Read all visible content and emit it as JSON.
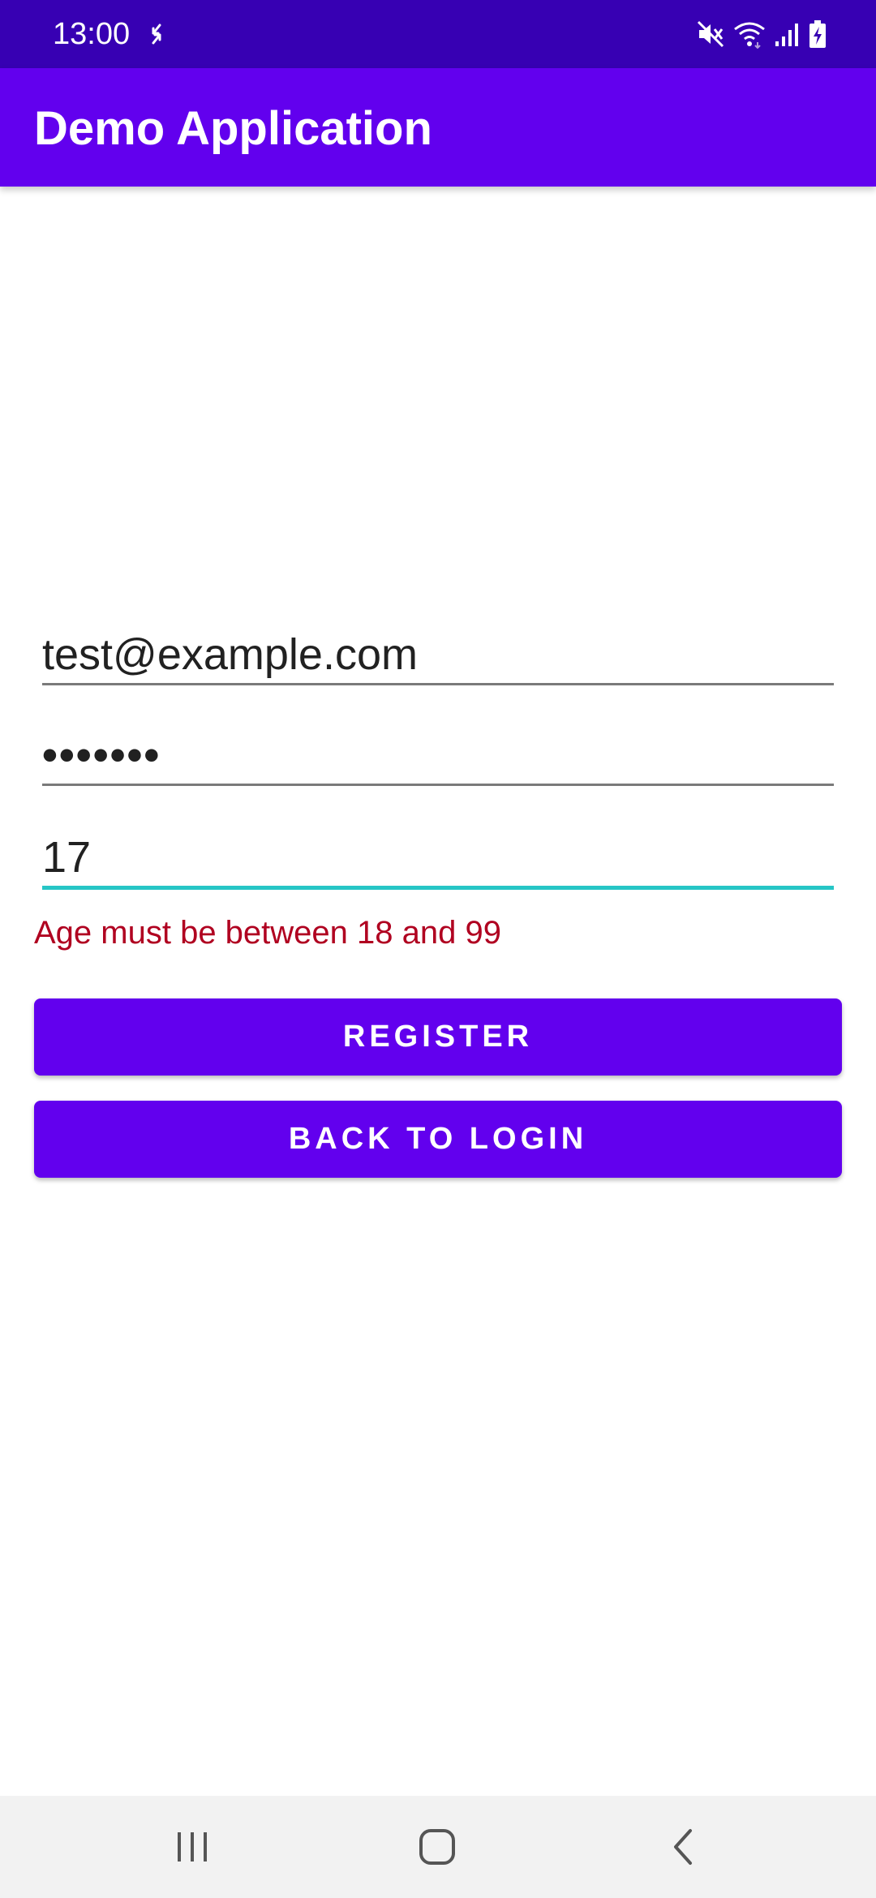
{
  "status_bar": {
    "time": "13:00",
    "icons": [
      "sync-icon",
      "mute-icon",
      "wifi-icon",
      "signal-icon",
      "battery-charging-icon"
    ]
  },
  "app_bar": {
    "title": "Demo Application",
    "color": "#6200ee"
  },
  "form": {
    "email": {
      "value": "test@example.com"
    },
    "password": {
      "value": "•••••••"
    },
    "age": {
      "value": "17",
      "focused": true
    },
    "error": "Age must be between 18 and 99",
    "error_color": "#b00020",
    "focus_color": "#26c6c6"
  },
  "buttons": {
    "register": "REGISTER",
    "back_to_login": "BACK TO LOGIN"
  },
  "nav_bar": {
    "icons": [
      "recents-icon",
      "home-icon",
      "back-icon"
    ]
  }
}
